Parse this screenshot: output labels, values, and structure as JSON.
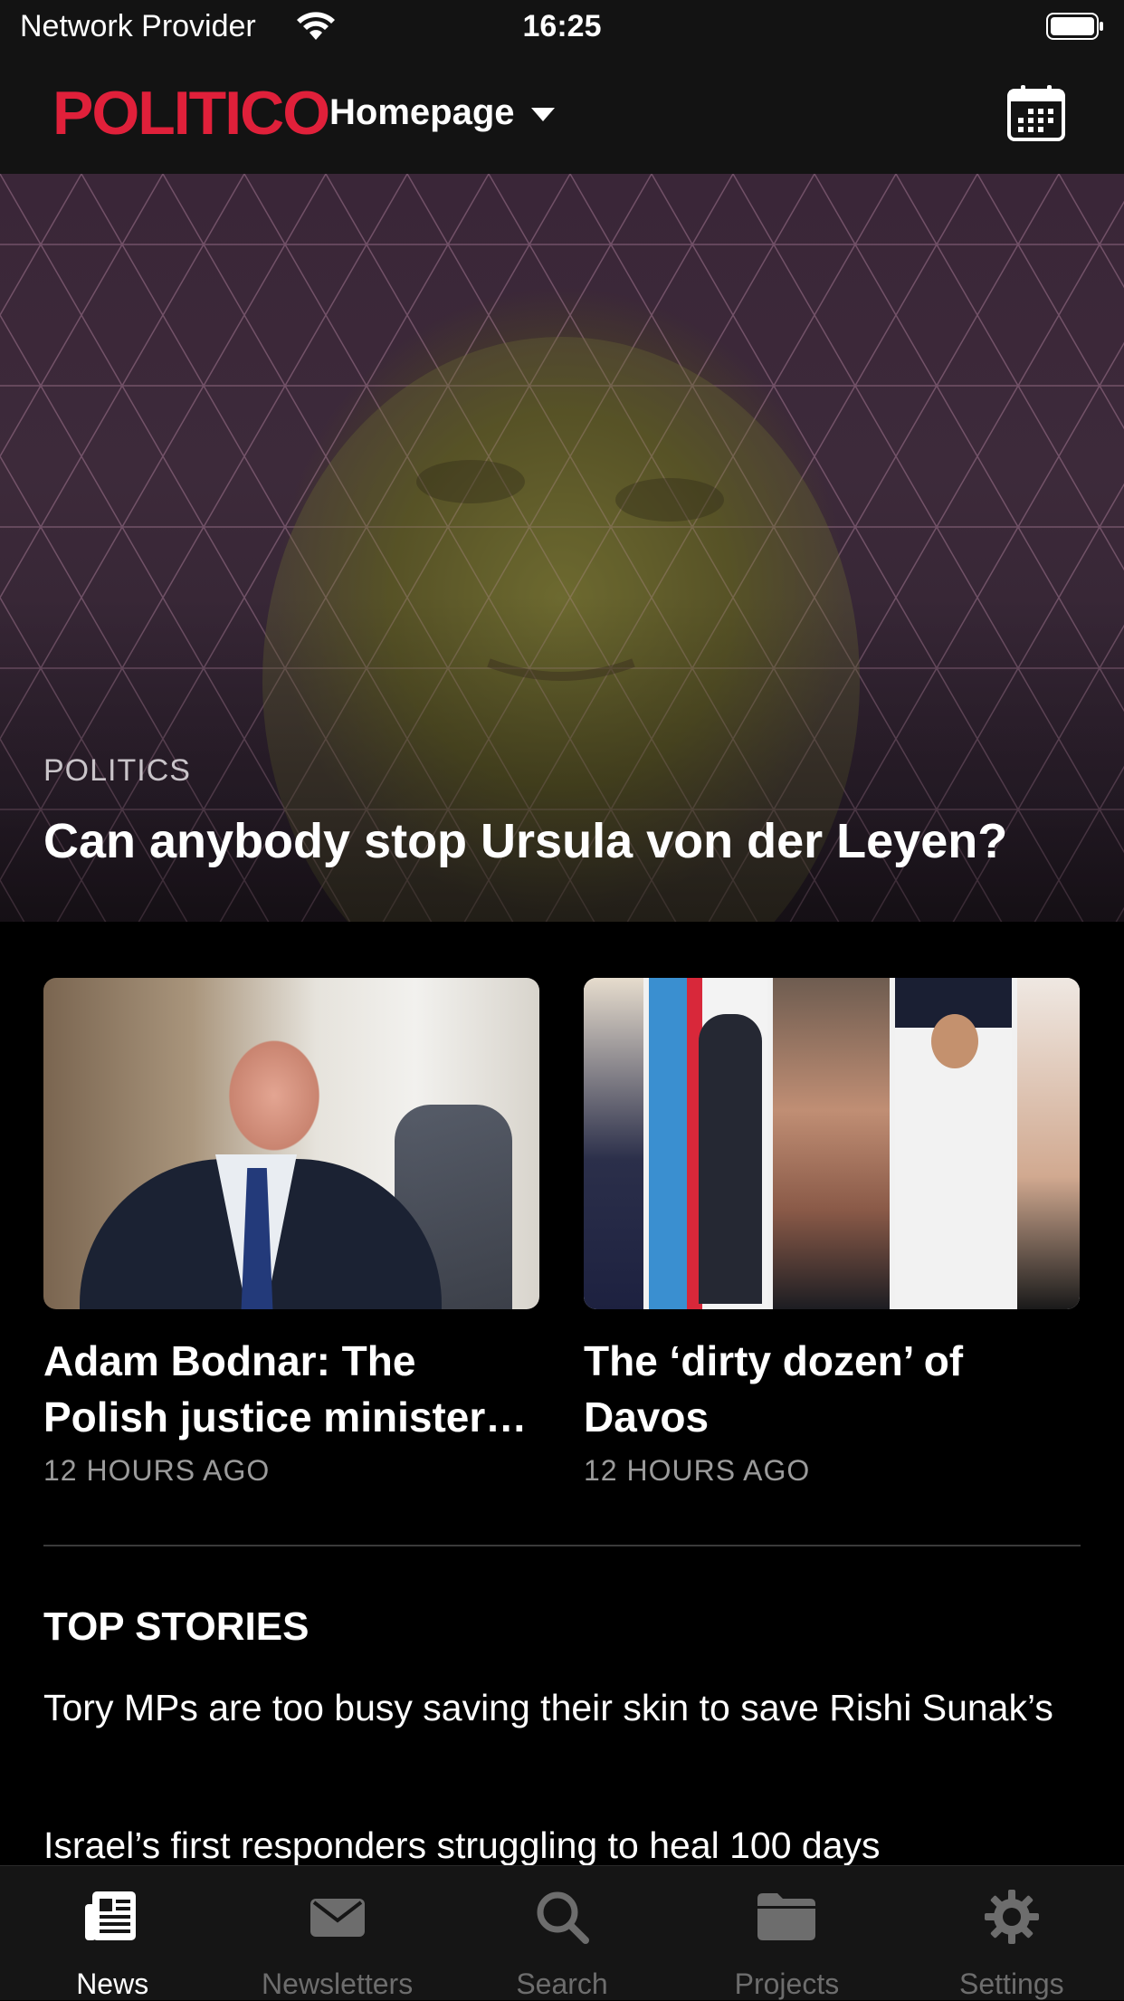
{
  "status_bar": {
    "carrier": "Network Provider",
    "time": "16:25"
  },
  "nav": {
    "logo": "POLITICO",
    "section": "Homepage",
    "accent_color": "#e0203a"
  },
  "hero": {
    "kicker": "POLITICS",
    "title": "Can anybody stop Ursula von der Leyen?"
  },
  "cards": [
    {
      "title": "Adam Bodnar: The Polish justice minister…",
      "time": "12 HOURS AGO"
    },
    {
      "title": "The ‘dirty dozen’ of Davos",
      "time": "12 HOURS AGO"
    }
  ],
  "top_stories": {
    "heading": "TOP STORIES",
    "items": [
      "Tory MPs are too busy saving their skin to save Rishi Sunak’s",
      "Israel’s first responders struggling to heal 100 days"
    ]
  },
  "tabs": [
    {
      "label": "News",
      "icon": "newspaper-icon",
      "active": true
    },
    {
      "label": "Newsletters",
      "icon": "envelope-icon",
      "active": false
    },
    {
      "label": "Search",
      "icon": "search-icon",
      "active": false
    },
    {
      "label": "Projects",
      "icon": "folder-icon",
      "active": false
    },
    {
      "label": "Settings",
      "icon": "gear-icon",
      "active": false
    }
  ]
}
